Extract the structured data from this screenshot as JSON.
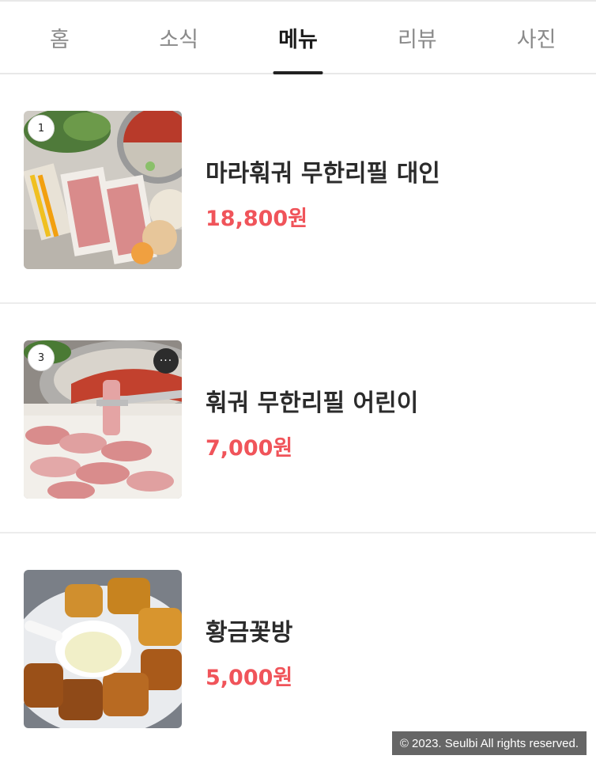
{
  "tabs": [
    {
      "label": "홈",
      "active": false
    },
    {
      "label": "소식",
      "active": false
    },
    {
      "label": "메뉴",
      "active": true
    },
    {
      "label": "리뷰",
      "active": false
    },
    {
      "label": "사진",
      "active": false
    }
  ],
  "menu_items": [
    {
      "rank": "1",
      "name": "마라훠궈 무한리필 대인",
      "price": "18,800원",
      "image": "hotpot-platter-photo"
    },
    {
      "rank": "3",
      "name": "훠궈 무한리필 어린이",
      "price": "7,000원",
      "image": "sliced-meat-hotpot-photo",
      "more_icon": "···"
    },
    {
      "name": "황금꽃방",
      "price": "5,000원",
      "image": "fried-bread-condensed-milk-photo"
    }
  ],
  "footer": {
    "copyright": "© 2023. Seulbi All rights reserved."
  },
  "colors": {
    "price": "#f0545a",
    "active_tab": "#1a1a1a",
    "inactive_tab": "#8a8a8a"
  }
}
